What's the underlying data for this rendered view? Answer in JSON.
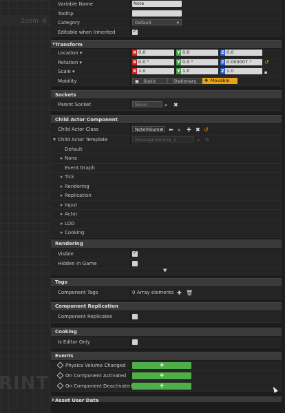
{
  "viewport": {
    "zoom": "Zoom -8",
    "watermark": "RINT"
  },
  "variable": {
    "name_label": "Variable Name",
    "name_value": "Note",
    "tooltip_label": "Tooltip",
    "tooltip_value": "",
    "category_label": "Category",
    "category_value": "Default",
    "editable_label": "Editable when Inherited",
    "editable_checked": true
  },
  "transform": {
    "title": "Transform",
    "location_label": "Location ▾",
    "location": [
      "0.0",
      "0.0",
      "0.0"
    ],
    "rotation_label": "Rotation ▾",
    "rotation": [
      "0.0 °",
      "0.0 °",
      "0.000007 °"
    ],
    "scale_label": "Scale ▾",
    "scale": [
      "1.0",
      "1.0",
      "1.0"
    ],
    "mobility_label": "Mobility",
    "mobility_options": [
      "Static",
      "Stationary",
      "Movable"
    ],
    "mobility_selected": "Movable",
    "axis_x": "X",
    "axis_y": "Y",
    "axis_z": "Z"
  },
  "sockets": {
    "title": "Sockets",
    "parent_label": "Parent Socket",
    "parent_value": "None"
  },
  "child_actor": {
    "title": "Child Actor Component",
    "class_label": "Child Actor Class",
    "class_value": "NoteVolume",
    "template_label": "Child Actor Template",
    "template_value": "MessageVolume_1",
    "tree": [
      "Default",
      "None",
      "Event Graph",
      "Tick",
      "Rendering",
      "Replication",
      "Input",
      "Actor",
      "LOD",
      "Cooking"
    ]
  },
  "rendering": {
    "title": "Rendering",
    "visible_label": "Visible",
    "visible_checked": true,
    "hidden_label": "Hidden in Game",
    "hidden_checked": false
  },
  "tags": {
    "title": "Tags",
    "component_tags_label": "Component Tags",
    "component_tags_value": "0 Array elements"
  },
  "replication": {
    "title": "Component Replication",
    "replicates_label": "Component Replicates",
    "replicates_checked": false
  },
  "cooking": {
    "title": "Cooking",
    "editor_only_label": "Is Editor Only",
    "editor_only_checked": false
  },
  "events": {
    "title": "Events",
    "items": [
      "Physics Volume Changed",
      "On Component Activated",
      "On Component Deactivated"
    ],
    "add_symbol": "+"
  },
  "asset_user_data": {
    "title": "Asset User Data"
  },
  "colors": {
    "accent": "#e8a317",
    "add_event": "#4fae47",
    "axis_x": "#c82020",
    "axis_y": "#49a24b",
    "axis_z": "#2c5bd6"
  }
}
